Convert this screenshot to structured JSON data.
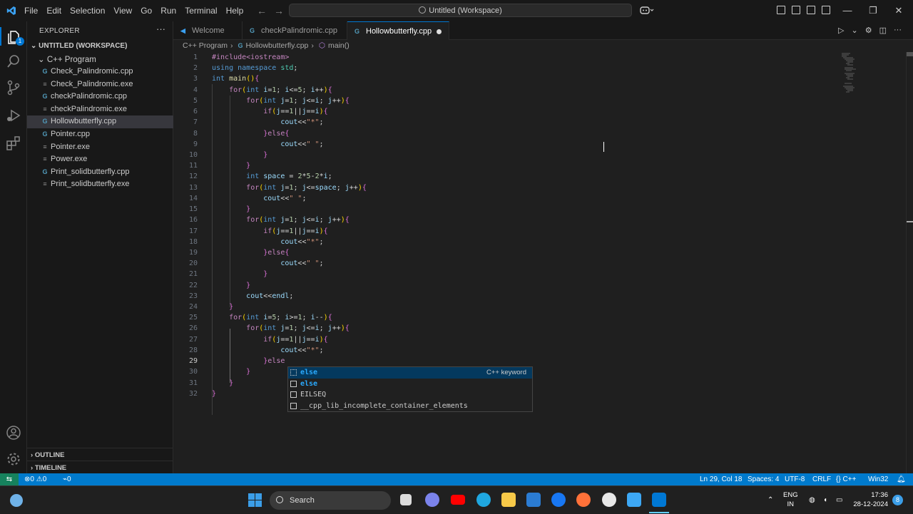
{
  "titlebar": {
    "menu": [
      "File",
      "Edit",
      "Selection",
      "View",
      "Go",
      "Run",
      "Terminal",
      "Help"
    ],
    "search_text": "Untitled (Workspace)"
  },
  "activity": {
    "badge": "1"
  },
  "explorer": {
    "title": "EXPLORER",
    "workspace": "UNTITLED (WORKSPACE)",
    "folder": "C++ Program",
    "files": [
      {
        "name": "Check_Palindromic.cpp",
        "type": "cpp"
      },
      {
        "name": "Check_Palindromic.exe",
        "type": "exe"
      },
      {
        "name": "checkPalindromic.cpp",
        "type": "cpp"
      },
      {
        "name": "checkPalindromic.exe",
        "type": "exe"
      },
      {
        "name": "Hollowbutterfly.cpp",
        "type": "cpp",
        "selected": true
      },
      {
        "name": "Pointer.cpp",
        "type": "cpp"
      },
      {
        "name": "Pointer.exe",
        "type": "exe"
      },
      {
        "name": "Power.exe",
        "type": "exe"
      },
      {
        "name": "Print_solidbutterfly.cpp",
        "type": "cpp"
      },
      {
        "name": "Print_solidbutterfly.exe",
        "type": "exe"
      }
    ],
    "outline": "OUTLINE",
    "timeline": "TIMELINE"
  },
  "tabs": [
    {
      "label": "Welcome"
    },
    {
      "label": "checkPalindromic.cpp"
    },
    {
      "label": "Hollowbutterfly.cpp",
      "active": true,
      "dirty": true
    }
  ],
  "breadcrumb": [
    "C++ Program",
    "Hollowbutterfly.cpp",
    "main()"
  ],
  "editor": {
    "line_numbers": [
      "1",
      "2",
      "3",
      "4",
      "5",
      "6",
      "7",
      "8",
      "9",
      "10",
      "11",
      "12",
      "13",
      "14",
      "15",
      "16",
      "17",
      "18",
      "19",
      "20",
      "21",
      "22",
      "23",
      "24",
      "25",
      "26",
      "27",
      "28",
      "29",
      "30",
      "31",
      "32"
    ],
    "current_line": 29,
    "lines": [
      "#include<iostream>",
      "using namespace std;",
      "int main(){",
      "    for(int i=1; i<=5; i++){",
      "        for(int j=1; j<=i; j++){",
      "            if(j==1||j==i){",
      "                cout<<\"*\";",
      "            }else{",
      "                cout<<\" \";",
      "            }",
      "        }",
      "        int space = 2*5-2*i;",
      "        for(int j=1; j<=space; j++){",
      "            cout<<\" \";",
      "        }",
      "        for(int j=1; j<=i; j++){",
      "            if(j==1||j==i){",
      "                cout<<\"*\";",
      "            }else{",
      "                cout<<\" \";",
      "            }",
      "        }",
      "        cout<<endl;",
      "    }",
      "    for(int i=5; i>=1; i--){",
      "        for(int j=1; j<=i; j++){",
      "            if(j==1||j==i){",
      "                cout<<\"*\";",
      "            }else",
      "        }",
      "    }",
      "}"
    ]
  },
  "suggest": {
    "items": [
      {
        "label": "else",
        "detail": "C++ keyword"
      },
      {
        "label": "else",
        "detail": ""
      },
      {
        "label": "EILSEQ",
        "detail": ""
      },
      {
        "label": "__cpp_lib_incomplete_container_elements",
        "detail": ""
      }
    ]
  },
  "status": {
    "errors": "0",
    "warnings": "0",
    "ports": "0",
    "position": "Ln 29, Col 18",
    "spaces": "Spaces: 4",
    "encoding": "UTF-8",
    "eol": "CRLF",
    "language": "C++",
    "platform": "Win32"
  },
  "taskbar": {
    "search": "Search",
    "lang1": "ENG",
    "lang2": "IN",
    "time": "17:36",
    "date": "28-12-2024",
    "notif": "8"
  },
  "colors": {
    "accent": "#007acc",
    "editor_bg": "#1f1f1f",
    "sidebar_bg": "#181818",
    "remote": "#16825d"
  }
}
